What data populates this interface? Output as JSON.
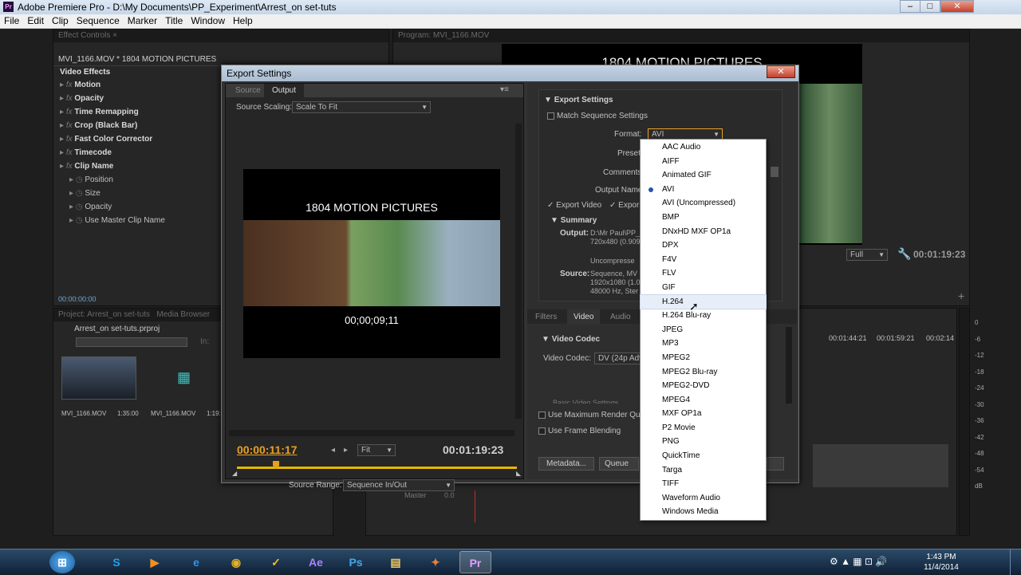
{
  "window": {
    "title": "Adobe Premiere Pro - D:\\My Documents\\PP_Experiment\\Arrest_on set-tuts",
    "minimize": "–",
    "maximize": "□",
    "close": "✕"
  },
  "menu": [
    "File",
    "Edit",
    "Clip",
    "Sequence",
    "Marker",
    "Title",
    "Window",
    "Help"
  ],
  "effect_controls": {
    "tab": "Effect Controls ×",
    "clip": "MVI_1166.MOV * 1804 MOTION PICTURES",
    "header": "Video Effects",
    "rows": [
      {
        "label": "Motion",
        "fx": true,
        "bold": true
      },
      {
        "label": "Opacity",
        "fx": true,
        "bold": true
      },
      {
        "label": "Time Remapping",
        "fx": true,
        "bold": true
      },
      {
        "label": "Crop (Black Bar)",
        "fx": true,
        "bold": true
      },
      {
        "label": "Fast Color Corrector",
        "fx": true,
        "bold": true
      },
      {
        "label": "Timecode",
        "fx": true,
        "bold": true
      },
      {
        "label": "Clip Name",
        "fx": true,
        "bold": true
      },
      {
        "label": "Position",
        "fx": false,
        "bold": false
      },
      {
        "label": "Size",
        "fx": false,
        "bold": false
      },
      {
        "label": "Opacity",
        "fx": false,
        "bold": false
      },
      {
        "label": "Use Master Clip Name",
        "fx": false,
        "bold": false
      }
    ],
    "timecode": "00:00:00:00"
  },
  "project": {
    "tab": "Project: Arrest_on set-tuts",
    "tab2": "Media Browser",
    "file": "Arrest_on set-tuts.prproj",
    "in_label": "In:",
    "items": [
      {
        "name": "MVI_1166.MOV",
        "duration": "1:35:00"
      },
      {
        "name": "MVI_1166.MOV",
        "duration": "1:19:"
      }
    ]
  },
  "program": {
    "tab": "Program: MVI_1166.MOV",
    "title_overlay": "1804 MOTION PICTURES",
    "fit": "Full",
    "timecode": "00:01:19:23"
  },
  "timeline": {
    "ruler": [
      "00:01:44:21",
      "00:01:59:21",
      "00:02:14"
    ],
    "master": "Master",
    "master_value": "0.0"
  },
  "meters": [
    "0",
    "-6",
    "-12",
    "-18",
    "-24",
    "-30",
    "-36",
    "-42",
    "-48",
    "-54",
    "dB"
  ],
  "dialog": {
    "title": "Export Settings",
    "close": "✕",
    "tabs": [
      "Source",
      "Output"
    ],
    "source_scaling_label": "Source Scaling:",
    "source_scaling_value": "Scale To Fit",
    "preview_title": "1804 MOTION PICTURES",
    "preview_timecode": "00;00;09;11",
    "current_time": "00:00:11:17",
    "fit": "Fit",
    "duration": "00:01:19:23",
    "source_range_label": "Source Range:",
    "source_range_value": "Sequence In/Out",
    "export_settings_header": "Export Settings",
    "match_sequence": "Match Sequence Settings",
    "format_label": "Format:",
    "format_value": "AVI",
    "preset_label": "Preset:",
    "comments_label": "Comments:",
    "output_name_label": "Output Name:",
    "export_video": "Export Video",
    "export_audio": "Expor",
    "summary_header": "Summary",
    "output_label": "Output:",
    "output_lines": [
      "D:\\Mr Paul\\PP_",
      "720x480 (0.909"
    ],
    "output_tail": "0",
    "uncompressed": "Uncompresse",
    "source_label": "Source:",
    "source_lines": [
      "Sequence, MV",
      "1920x1080 (1.0",
      "48000 Hz, Ster"
    ],
    "source_tail": "0",
    "lower_tabs": [
      "Filters",
      "Video",
      "Audio"
    ],
    "video_codec_header": "Video Codec",
    "video_codec_label": "Video Codec:",
    "video_codec_value": "DV (24p Adv",
    "basic_video": "Basic Video Settings",
    "max_render": "Use Maximum Render Qualit",
    "frame_blending": "Use Frame Blending",
    "metadata_button": "Metadata...",
    "queue_button": "Queue"
  },
  "format_options": [
    "AAC Audio",
    "AIFF",
    "Animated GIF",
    "AVI",
    "AVI (Uncompressed)",
    "BMP",
    "DNxHD MXF OP1a",
    "DPX",
    "F4V",
    "FLV",
    "GIF",
    "H.264",
    "H.264 Blu-ray",
    "JPEG",
    "MP3",
    "MPEG2",
    "MPEG2 Blu-ray",
    "MPEG2-DVD",
    "MPEG4",
    "MXF OP1a",
    "P2 Movie",
    "PNG",
    "QuickTime",
    "Targa",
    "TIFF",
    "Waveform Audio",
    "Windows Media"
  ],
  "format_selected": "AVI",
  "format_hover": "H.264",
  "taskbar": {
    "apps": [
      {
        "name": "start",
        "glyph": "⊞",
        "color": "#3d9be9"
      },
      {
        "name": "skype",
        "glyph": "S",
        "color": "#1fa3e6"
      },
      {
        "name": "media-player",
        "glyph": "▶",
        "color": "#f09020"
      },
      {
        "name": "internet-explorer",
        "glyph": "e",
        "color": "#3a8fe0"
      },
      {
        "name": "chrome",
        "glyph": "◉",
        "color": "#e8b020"
      },
      {
        "name": "norton",
        "glyph": "✓",
        "color": "#f0c020"
      },
      {
        "name": "after-effects",
        "glyph": "Ae",
        "color": "#b080ff"
      },
      {
        "name": "photoshop",
        "glyph": "Ps",
        "color": "#40a8f0"
      },
      {
        "name": "explorer",
        "glyph": "▤",
        "color": "#f0c860"
      },
      {
        "name": "app-orange",
        "glyph": "✦",
        "color": "#f08030"
      },
      {
        "name": "premiere",
        "glyph": "Pr",
        "color": "#e0a0ff"
      }
    ],
    "time": "1:43 PM",
    "date": "11/4/2014"
  }
}
